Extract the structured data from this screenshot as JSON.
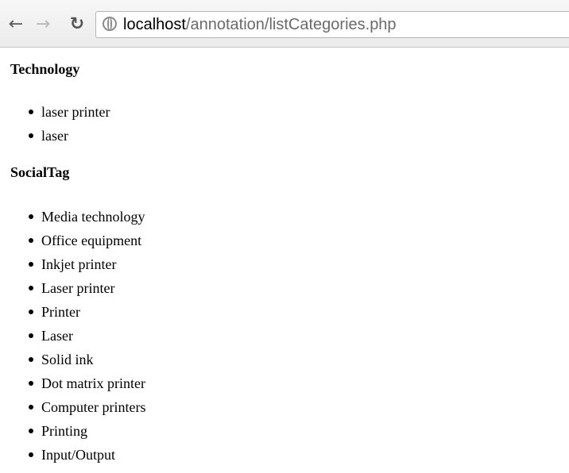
{
  "browser": {
    "url_host": "localhost",
    "url_path": "/annotation/listCategories.php"
  },
  "categories": [
    {
      "heading": "Technology",
      "items": [
        "laser printer",
        "laser"
      ]
    },
    {
      "heading": "SocialTag",
      "items": [
        "Media technology",
        "Office equipment",
        "Inkjet printer",
        "Laser printer",
        "Printer",
        "Laser",
        "Solid ink",
        "Dot matrix printer",
        "Computer printers",
        "Printing",
        "Input/Output"
      ]
    }
  ]
}
